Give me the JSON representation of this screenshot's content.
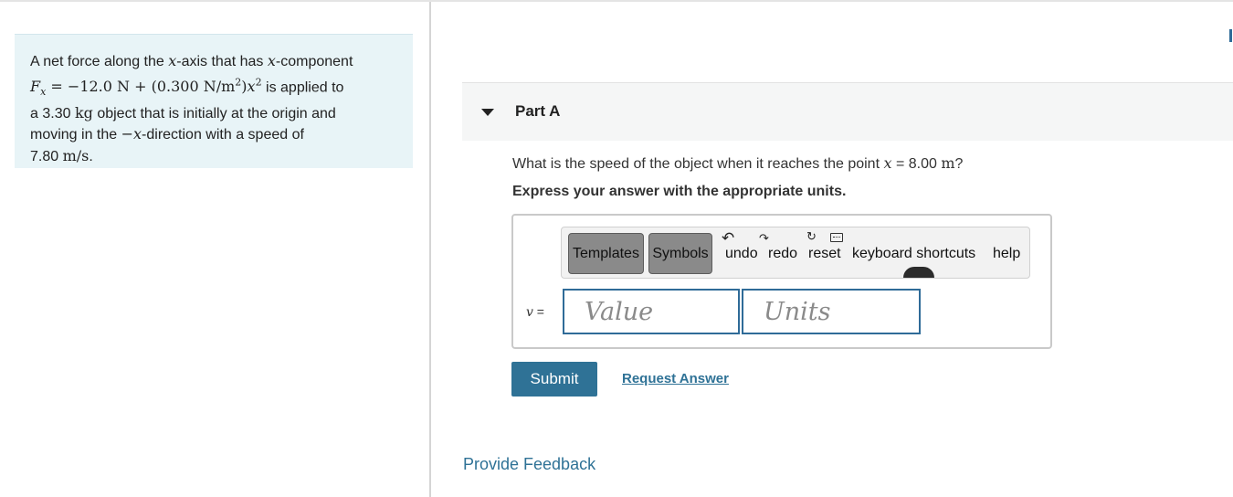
{
  "problem": {
    "line1_a": "A net force along the ",
    "x": "x",
    "line1_b": "-axis that has ",
    "line1_c": "-component",
    "F": "F",
    "eq": " = −12.0 N + (0.300 N/m",
    "sq": "2",
    "close": ")",
    "applied": " is applied to",
    "line3_a": "a 3.30 ",
    "kg": "kg",
    "line3_b": " object that is initially at the origin and",
    "line4_a": "moving in the ",
    "neg": "−",
    "line4_b": "-direction with a speed of",
    "line5_a": "7.80 ",
    "mps": "m/s",
    "period": "."
  },
  "part": {
    "title": "Part A",
    "question_a": "What is the speed of the object when it reaches the point ",
    "question_x": "x",
    "question_b": " = 8.00 ",
    "question_m": "m",
    "question_c": "?",
    "instructions": "Express your answer with the appropriate units."
  },
  "toolbar": {
    "templates": "Templates",
    "symbols": "Symbols",
    "undo": "undo",
    "redo": "redo",
    "reset": "reset",
    "keyboard": "keyboard shortcuts",
    "help": "help",
    "icons": [
      "undo-icon",
      "redo-icon",
      "reset-icon",
      "keyboard-icon"
    ]
  },
  "answer": {
    "variable": "v",
    "equals": " =",
    "value_placeholder": "Value",
    "units_placeholder": "Units"
  },
  "actions": {
    "submit": "Submit",
    "request_answer": "Request Answer"
  },
  "footer": {
    "feedback": "Provide Feedback"
  },
  "colors": {
    "accent": "#2f7296",
    "problem_bg": "#e8f4f7",
    "part_header_bg": "#f5f6f6"
  }
}
